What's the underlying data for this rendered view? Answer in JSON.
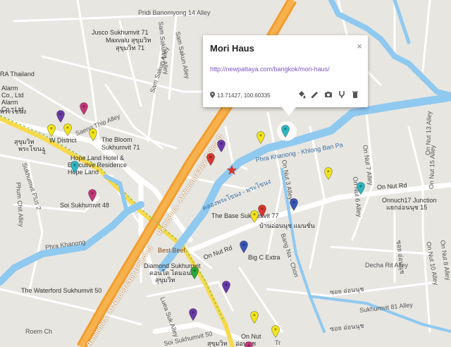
{
  "popup": {
    "title": "Mori Haus",
    "link": "http://newpattaya.com/bangkok/mori-haus/",
    "coords": "13.71427, 100.60335",
    "close": "×"
  },
  "labels": {
    "pridi": "Pridi Banomyong 14 Alley",
    "jusco": "Jusco Sukhumvit 71",
    "maxvalu": "Maxvalu สุขุมวิท",
    "sukhumvit71": "สุขุมวิท 71",
    "samsakun1": "Sam Sakun 1 Alley",
    "samsakun_a": "Sam Sakun Alley",
    "samsakun_b": "Sam Sakun Alley",
    "ra_thailand": "RA Thailand",
    "alarm1": "Alarm",
    "alarm1b": "Co., Ltd",
    "alarm2": "Alarm",
    "alarm2b": "Co., Ltd",
    "saeng_thip": "Saeng Thip Alley",
    "bloom1": "The Bloom",
    "bloom2": "Sukhumvit 71",
    "wdistrict": "W District",
    "hopeland1": "Hope Land Hotel &",
    "hopeland2": "Executive Residence",
    "hopeland3": "Hope Land",
    "phra_thai": "พระโขนง",
    "thai_sukhumvit": "สุขุมวิท",
    "thai_phra": "พระโขนง",
    "sukhumvit_plus": "Sukhumvit Plus 2",
    "soi4": "4",
    "phum_chit": "Phum Chit Alley",
    "soi_sukhumvit48": "Soi Sukhumvit 48",
    "phra_khanong": "Phra Khanong",
    "ramindhra1": "Ramindhra - At Narong Expy (Tollroad)",
    "ramindhra2": "Ramindhra - At Narong Expy (Tollroad)",
    "canal_thai": "คลองพระโขนง - พระโขนง",
    "phra_canal": "Phra Khanong - Khlong Ban Pa",
    "base1": "The Base Sukhumvit 77",
    "base_thai": "บ้านอ่อนนุช แมนชั่น",
    "on_nut3": "On Nut 3 Alley",
    "on_nut7": "On Nut 7 Alley",
    "on_nut13": "On Nut 13 Alley",
    "on_nut15": "On Nut 15 Alley",
    "on_nut6": "On Nut 6 Alley",
    "on_nut10": "On Nut 10 Alley",
    "on_nut8": "On Nut 8 Alley",
    "on_nut_rd1": "On Nut Rd",
    "on_nut_rd2": "On Nut Rd",
    "onnuch17a": "Onnuch17 Junction",
    "onnuch17b": "แยกอ่อนนุช 15",
    "thai_onnut_v": "ซอย อ่อนนุช",
    "best_beef": "Best Beef",
    "bigc": "Big C Extra",
    "diamond1": "Diamond Sukhumvit",
    "diamond2": "คอนโด ไดมอนด์",
    "diamond3": "สุขุมวิท",
    "bang_na": "Bang Na - Chon",
    "decha": "Decha Rit Alley",
    "thai_onnut2": "ซอย อ่อนนุช",
    "sukhumvit81": "Sukhumvit 81 Alley",
    "thai_onnut3": "ซอย อ่อนนุช",
    "waterford": "The Waterford Sukhumvit 50",
    "luea_suk": "Luea Suk Alley",
    "soi_sukhumvit50": "Soi Sukhumvit 50",
    "on_nut_bts": "On Nut",
    "on_nut_thai": "อ่อนนุช",
    "thai_sukh2": "สุขุมวิท",
    "roem": "Roem Ch",
    "reddot": "Tr"
  },
  "markers": {
    "colors": {
      "yellow": "#f2e41a",
      "purple": "#6a3aa8",
      "pink": "#c2367a",
      "teal": "#2bb6c2",
      "red": "#d9362e",
      "blue": "#3a55b8",
      "green": "#2aa836",
      "star": "#d8342a"
    },
    "list": [
      {
        "name": "pin-purple-1",
        "color": "purple"
      },
      {
        "name": "pin-pink-1",
        "color": "pink"
      },
      {
        "name": "pin-yellow-1",
        "color": "yellow"
      },
      {
        "name": "pin-yellow-2",
        "color": "yellow"
      },
      {
        "name": "pin-yellow-3",
        "color": "yellow"
      },
      {
        "name": "pin-teal-1",
        "color": "teal"
      },
      {
        "name": "pin-pink-2",
        "color": "pink"
      },
      {
        "name": "pin-red-1",
        "color": "red"
      },
      {
        "name": "pin-purple-2",
        "color": "purple"
      },
      {
        "name": "pin-yellow-4",
        "color": "yellow"
      },
      {
        "name": "pin-teal-selected",
        "color": "teal"
      },
      {
        "name": "pin-yellow-5",
        "color": "yellow"
      },
      {
        "name": "pin-teal-2",
        "color": "teal"
      },
      {
        "name": "pin-blue-1",
        "color": "blue"
      },
      {
        "name": "pin-yellow-6",
        "color": "yellow"
      },
      {
        "name": "pin-red-2",
        "color": "red"
      },
      {
        "name": "pin-blue-2",
        "color": "blue"
      },
      {
        "name": "pin-green-1",
        "color": "green"
      },
      {
        "name": "pin-purple-3",
        "color": "purple"
      },
      {
        "name": "pin-purple-4",
        "color": "purple"
      },
      {
        "name": "pin-yellow-7",
        "color": "yellow"
      },
      {
        "name": "pin-yellow-8",
        "color": "yellow"
      },
      {
        "name": "pin-pink-3",
        "color": "pink"
      }
    ]
  }
}
